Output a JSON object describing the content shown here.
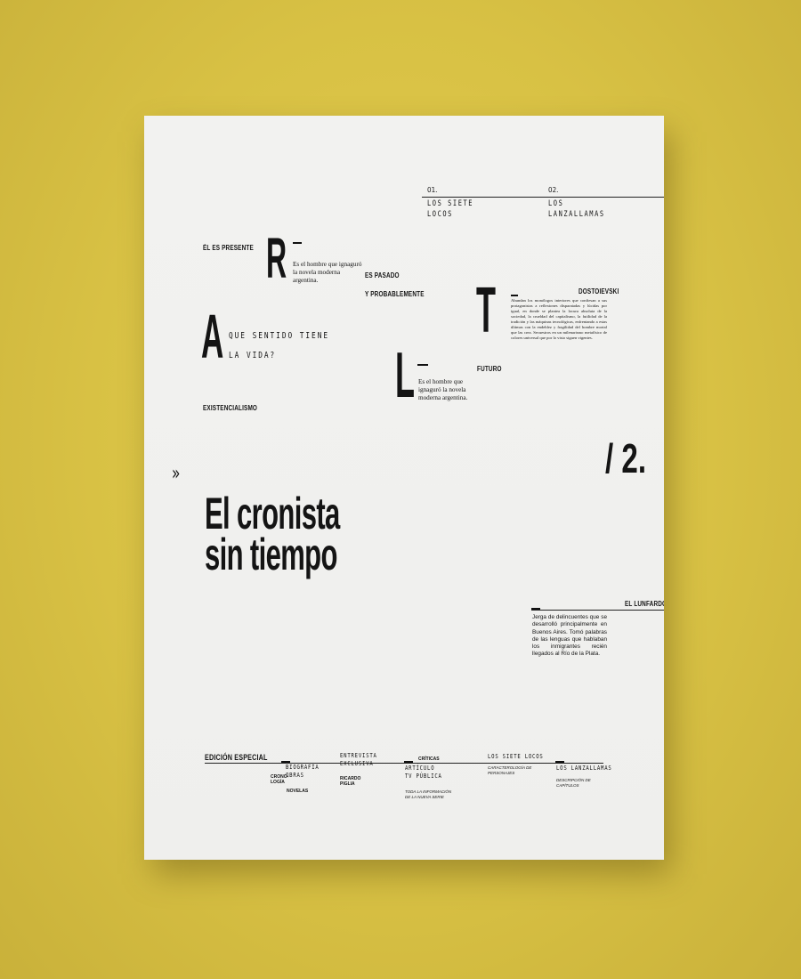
{
  "nav": {
    "item1_num": "01.",
    "item1_title": "LOS SIETE\nLOCOS",
    "item2_num": "02.",
    "item2_title": "LOS\nLANZALLAMAS"
  },
  "letters": {
    "r": "R",
    "a": "A",
    "t": "T",
    "l": "L"
  },
  "labels": {
    "el_es_presente": "ÉL ES PRESENTE",
    "es_pasado": "ES PASADO",
    "y_probablemente": "Y PROBABLEMENTE",
    "existencialismo": "EXISTENCIALISMO",
    "futuro": "FUTURO",
    "dostoievski": "DOSTOIEVSKI"
  },
  "quotes": {
    "r_text": "Es el hombre que ignaguró la novela moderna argentina.",
    "l_text": "Es el hombre que ignaguró la novela moderna argentina.",
    "question": "QUE SENTIDO TIENE\nLA VIDA?"
  },
  "dostoievski_text": "Abundan los monólogos interiores que confiesan a sus protagonistas a reflexiones disparatadas y lúcidas por igual, en donde se plantea la locura absoluta de la sociedad, la crueldad del capitalismo, la futilidad de la tradición y las máquinas tecnológicas, enfrentando a estas últimas con la endeblez y fragilidad del hombre mortal que las crea. Secuestros en un milenarismo metafísico de colores universal que por lo visto siguen vigentes.",
  "arrows": "»",
  "title": "El cronista\nsin tiempo",
  "section_number": "/ 2.",
  "lunfardo": {
    "heading": "EL LUNFARDO",
    "text": "Jerga de delincuentes que se desarrolló principalmente en Buenos Aires. Tomó palabras de las lenguas que hablaban los inmigrantes recién llegados al Río de la Plata."
  },
  "footer": {
    "edition": "EDICIÓN ESPECIAL",
    "biografia": "BIOGRAFÍA\nOBRAS",
    "cronologia": "CRONO-\nLOGÍA",
    "novelas": "NOVELAS",
    "entrevista": "ENTREVISTA\nEXCLUSIVA",
    "ricardo": "RICARDO\nPIGLIA",
    "criticas": "CRÍTICAS",
    "articulo": "ARTÍCULO\nTV PÚBLICA",
    "toda_info": "TODA LA INFORMACIÓN\nDE LA NUEVA SERIE",
    "siete_locos": "LOS SIETE LOCOS",
    "caracterologia": "CARACTEROLOGÍA DE\nPERSONAJES",
    "lanzallamas": "LOS LANZALLAMAS",
    "descripcion": "DESCRIPCIÓN DE\nCAPÍTULOS"
  }
}
